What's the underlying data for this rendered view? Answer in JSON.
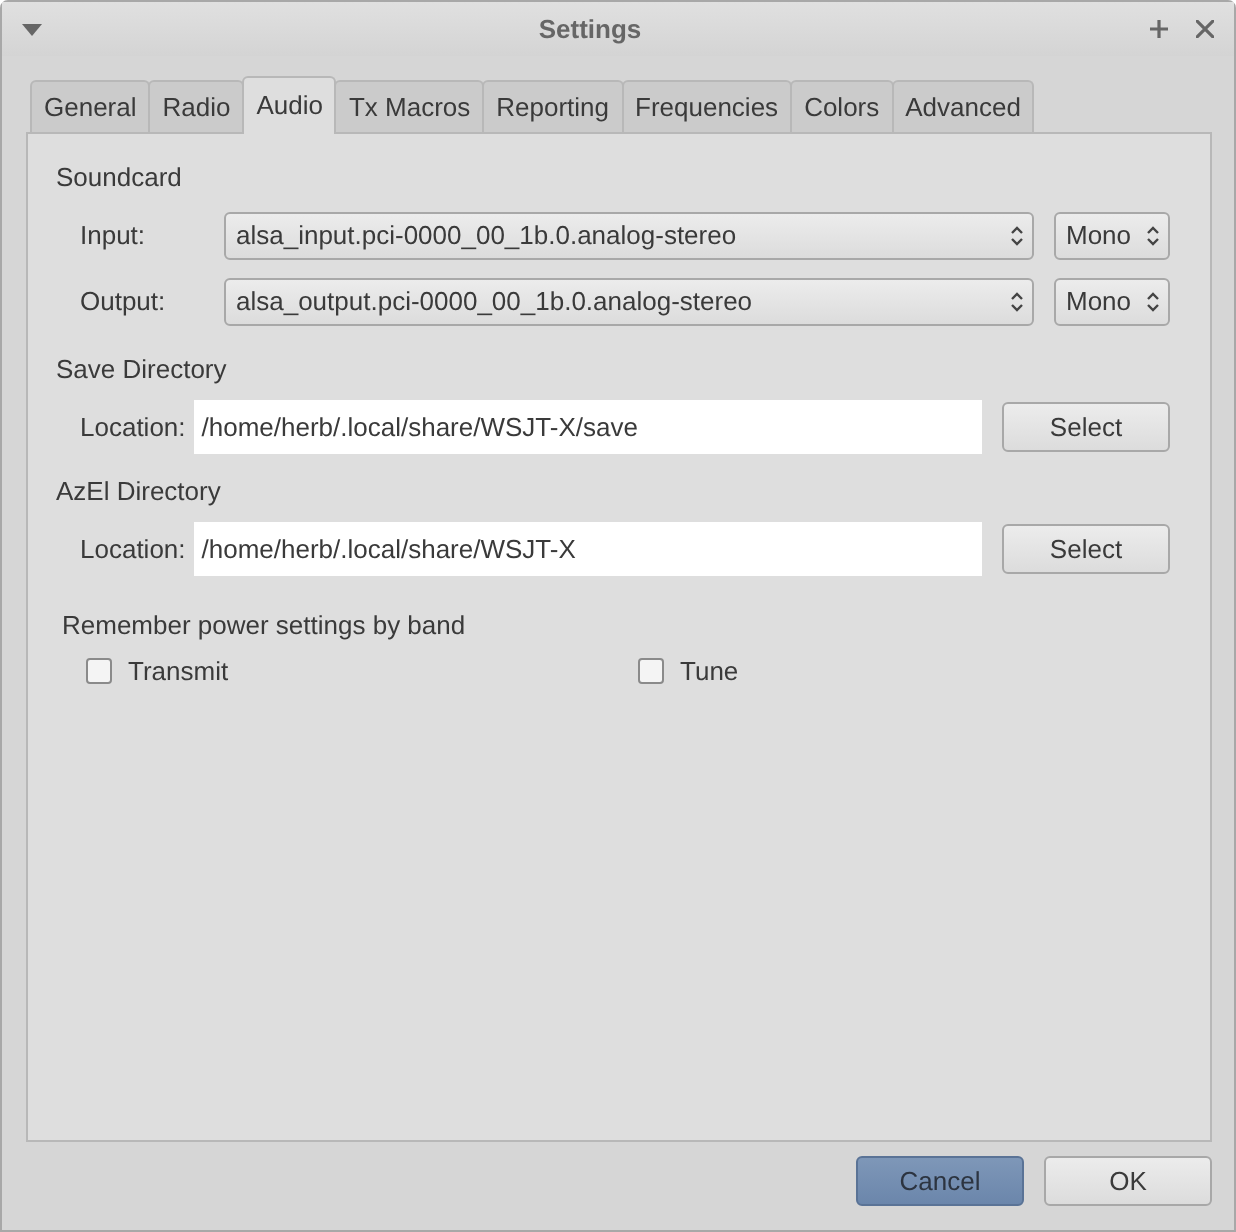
{
  "window": {
    "title": "Settings"
  },
  "tabs": [
    {
      "label": "General",
      "selected": false
    },
    {
      "label": "Radio",
      "selected": false
    },
    {
      "label": "Audio",
      "selected": true
    },
    {
      "label": "Tx Macros",
      "selected": false
    },
    {
      "label": "Reporting",
      "selected": false
    },
    {
      "label": "Frequencies",
      "selected": false
    },
    {
      "label": "Colors",
      "selected": false
    },
    {
      "label": "Advanced",
      "selected": false
    }
  ],
  "soundcard": {
    "title": "Soundcard",
    "rows": [
      {
        "label": "Input:",
        "device": "alsa_input.pci-0000_00_1b.0.analog-stereo",
        "channel": "Mono"
      },
      {
        "label": "Output:",
        "device": "alsa_output.pci-0000_00_1b.0.analog-stereo",
        "channel": "Mono"
      }
    ]
  },
  "directories": [
    {
      "title": "Save Directory",
      "label": "Location:",
      "value": "/home/herb/.local/share/WSJT-X/save",
      "button": "Select"
    },
    {
      "title": "AzEl Directory",
      "label": "Location:",
      "value": "/home/herb/.local/share/WSJT-X",
      "button": "Select"
    }
  ],
  "power": {
    "title": "Remember power settings by band",
    "options": [
      {
        "label": "Transmit",
        "checked": false
      },
      {
        "label": "Tune",
        "checked": false
      }
    ]
  },
  "buttons": [
    {
      "label": "Cancel",
      "focused": true
    },
    {
      "label": "OK",
      "focused": false
    }
  ]
}
